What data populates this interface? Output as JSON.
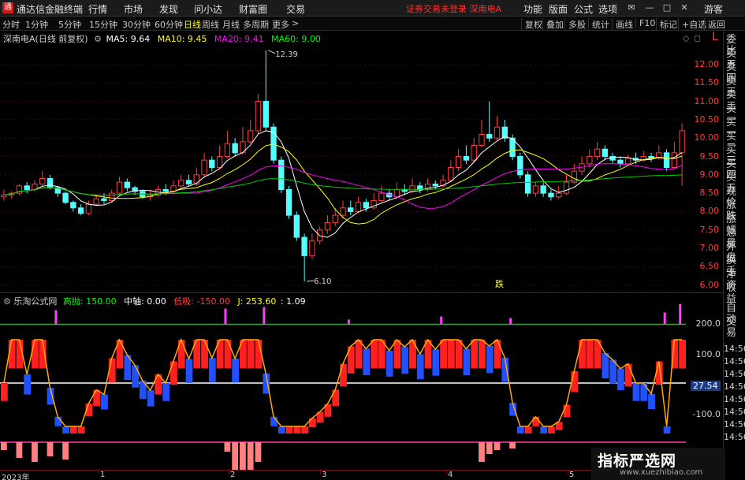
{
  "app": {
    "logo_char": "通",
    "name": "通达信金融终端",
    "menu": [
      "行情",
      "市场",
      "发现",
      "问小达",
      "财富圈",
      "交易"
    ],
    "notice": "证券交易未登录  深南电A",
    "right_menu": [
      "功能",
      "版面",
      "公式",
      "选项"
    ],
    "guest": "游客"
  },
  "toolbar": {
    "periods": [
      "分时",
      "1分钟",
      "5分钟",
      "15分钟",
      "30分钟",
      "60分钟",
      "日线",
      "周线",
      "月线",
      "多周期",
      "更多"
    ],
    "active_period": "日线",
    "buttons": [
      "复权",
      "叠加",
      "多股",
      "统计",
      "画线",
      "F10",
      "标记",
      "+自选",
      "返回"
    ]
  },
  "main_chart": {
    "stock_title": "深南电A(日线 前复权)",
    "ma": [
      {
        "label": "MA5: 9.64",
        "color": "#ffffff"
      },
      {
        "label": "MA10: 9.45",
        "color": "#ffff00"
      },
      {
        "label": "MA20: 9.41",
        "color": "#ff00ff"
      },
      {
        "label": "MA60: 9.00",
        "color": "#00ff00"
      }
    ],
    "high_label": "12.39",
    "low_label": "6.10",
    "annotation": "跌",
    "price_ticks": [
      "12.00",
      "11.50",
      "11.00",
      "10.50",
      "10.00",
      "9.50",
      "9.00",
      "8.50",
      "8.00",
      "7.50",
      "7.00",
      "6.50",
      "6.00"
    ]
  },
  "indicator": {
    "name": "乐淘公式网",
    "items": [
      {
        "label": "高抛: 150.00",
        "color": "#00ff00"
      },
      {
        "label": "中轴: 0.00",
        "color": "#ffffff"
      },
      {
        "label": "低吸: -150.00",
        "color": "#ff3c3c"
      },
      {
        "label": "J: 253.60",
        "color": "#ffff00"
      },
      {
        "label": ": 1.09",
        "color": "#ffffff"
      }
    ],
    "ticks": [
      "200.0",
      "100.0",
      "-100.0"
    ],
    "current_value": "27.54"
  },
  "sidebar": {
    "items": [
      "委比",
      "卖五",
      "卖四",
      "卖三",
      "卖二",
      "卖一",
      "买一",
      "买二",
      "买三",
      "买四",
      "买五",
      "现价",
      "涨跌",
      "涨幅",
      "总量",
      "外盘",
      "换手",
      "净资",
      "收益",
      "自动",
      "交易"
    ],
    "times": [
      "14:56",
      "14:56",
      "14:56",
      "14:56",
      "14:56",
      "14:56",
      "14:56",
      "14:56"
    ]
  },
  "date_axis": [
    "2023年",
    "1",
    "2",
    "3",
    "4",
    "5"
  ],
  "watermark": {
    "title": "指标严选网",
    "url": "www.xuezhibiao.com"
  },
  "chart_data": {
    "type": "candlestick",
    "ylim": [
      5.8,
      12.6
    ],
    "candles": [
      [
        8.4,
        8.45,
        8.6,
        8.3
      ],
      [
        8.45,
        8.5,
        8.55,
        8.35
      ],
      [
        8.5,
        8.7,
        8.75,
        8.45
      ],
      [
        8.7,
        8.6,
        8.8,
        8.5
      ],
      [
        8.6,
        8.75,
        8.85,
        8.55
      ],
      [
        8.75,
        8.9,
        9.1,
        8.7
      ],
      [
        8.9,
        8.65,
        9.0,
        8.6
      ],
      [
        8.65,
        8.5,
        8.7,
        8.4
      ],
      [
        8.5,
        8.25,
        8.55,
        8.2
      ],
      [
        8.25,
        8.1,
        8.3,
        8.0
      ],
      [
        8.1,
        7.95,
        8.2,
        7.9
      ],
      [
        7.95,
        8.2,
        8.3,
        7.9
      ],
      [
        8.2,
        8.35,
        8.45,
        8.15
      ],
      [
        8.35,
        8.3,
        8.5,
        8.2
      ],
      [
        8.3,
        8.5,
        8.6,
        8.25
      ],
      [
        8.5,
        8.8,
        8.95,
        8.45
      ],
      [
        8.8,
        8.65,
        8.9,
        8.55
      ],
      [
        8.65,
        8.55,
        8.7,
        8.45
      ],
      [
        8.55,
        8.4,
        8.6,
        8.35
      ],
      [
        8.4,
        8.45,
        8.6,
        8.3
      ],
      [
        8.45,
        8.6,
        8.7,
        8.4
      ],
      [
        8.6,
        8.55,
        8.75,
        8.45
      ],
      [
        8.55,
        8.7,
        8.85,
        8.5
      ],
      [
        8.7,
        8.85,
        9.0,
        8.65
      ],
      [
        8.85,
        8.75,
        9.0,
        8.7
      ],
      [
        8.75,
        9.0,
        9.2,
        8.7
      ],
      [
        9.0,
        9.4,
        9.6,
        8.95
      ],
      [
        9.4,
        9.2,
        9.5,
        9.1
      ],
      [
        9.2,
        9.5,
        9.8,
        9.15
      ],
      [
        9.5,
        9.85,
        10.2,
        9.45
      ],
      [
        9.85,
        9.6,
        10.0,
        9.5
      ],
      [
        9.6,
        9.9,
        10.3,
        9.55
      ],
      [
        9.9,
        10.2,
        10.5,
        9.85
      ],
      [
        10.2,
        11.0,
        11.2,
        10.1
      ],
      [
        11.0,
        10.3,
        12.39,
        10.2
      ],
      [
        10.3,
        9.4,
        10.4,
        9.3
      ],
      [
        9.4,
        8.6,
        9.5,
        8.5
      ],
      [
        8.6,
        7.9,
        8.7,
        7.8
      ],
      [
        7.9,
        7.3,
        8.0,
        7.2
      ],
      [
        7.3,
        6.8,
        7.4,
        6.1
      ],
      [
        6.8,
        7.2,
        7.4,
        6.7
      ],
      [
        7.2,
        7.5,
        7.6,
        7.1
      ],
      [
        7.5,
        7.7,
        7.9,
        7.4
      ],
      [
        7.7,
        7.9,
        8.1,
        7.6
      ],
      [
        7.9,
        8.1,
        8.3,
        7.8
      ],
      [
        8.1,
        8.0,
        8.3,
        7.9
      ],
      [
        8.0,
        8.25,
        8.4,
        7.95
      ],
      [
        8.25,
        8.1,
        8.35,
        8.0
      ],
      [
        8.1,
        8.3,
        8.5,
        8.05
      ],
      [
        8.3,
        8.5,
        8.7,
        8.25
      ],
      [
        8.5,
        8.4,
        8.6,
        8.3
      ],
      [
        8.4,
        8.6,
        8.8,
        8.35
      ],
      [
        8.6,
        8.55,
        8.75,
        8.45
      ],
      [
        8.55,
        8.7,
        8.9,
        8.5
      ],
      [
        8.7,
        8.6,
        8.8,
        8.5
      ],
      [
        8.6,
        8.75,
        8.9,
        8.55
      ],
      [
        8.75,
        8.7,
        8.85,
        8.6
      ],
      [
        8.7,
        8.85,
        9.0,
        8.65
      ],
      [
        8.85,
        9.2,
        9.4,
        8.8
      ],
      [
        9.2,
        9.5,
        9.7,
        9.1
      ],
      [
        9.5,
        9.4,
        9.8,
        9.3
      ],
      [
        9.4,
        9.8,
        10.0,
        9.35
      ],
      [
        9.8,
        10.1,
        10.5,
        9.75
      ],
      [
        10.1,
        10.0,
        11.0,
        9.9
      ],
      [
        10.0,
        10.3,
        10.6,
        9.95
      ],
      [
        10.3,
        10.0,
        10.5,
        9.9
      ],
      [
        10.0,
        9.5,
        10.1,
        9.4
      ],
      [
        9.5,
        9.0,
        9.6,
        8.9
      ],
      [
        9.0,
        8.5,
        9.1,
        8.4
      ],
      [
        8.5,
        8.7,
        8.8,
        8.4
      ],
      [
        8.7,
        8.5,
        8.8,
        8.4
      ],
      [
        8.5,
        8.4,
        8.6,
        8.3
      ],
      [
        8.4,
        8.5,
        8.7,
        8.35
      ],
      [
        8.5,
        8.8,
        9.0,
        8.45
      ],
      [
        8.8,
        9.1,
        9.3,
        8.75
      ],
      [
        9.1,
        9.3,
        9.5,
        9.0
      ],
      [
        9.3,
        9.5,
        9.7,
        9.2
      ],
      [
        9.5,
        9.7,
        9.9,
        9.4
      ],
      [
        9.7,
        9.5,
        9.8,
        9.4
      ],
      [
        9.5,
        9.4,
        9.6,
        9.3
      ],
      [
        9.4,
        9.3,
        9.5,
        9.2
      ],
      [
        9.3,
        9.45,
        9.55,
        9.25
      ],
      [
        9.45,
        9.4,
        9.6,
        9.3
      ],
      [
        9.4,
        9.5,
        9.65,
        9.35
      ],
      [
        9.5,
        9.45,
        9.6,
        9.35
      ],
      [
        9.45,
        9.6,
        9.8,
        9.4
      ],
      [
        9.6,
        9.2,
        9.7,
        9.1
      ],
      [
        9.2,
        9.6,
        9.9,
        9.15
      ],
      [
        9.6,
        10.2,
        10.4,
        8.7
      ]
    ]
  }
}
